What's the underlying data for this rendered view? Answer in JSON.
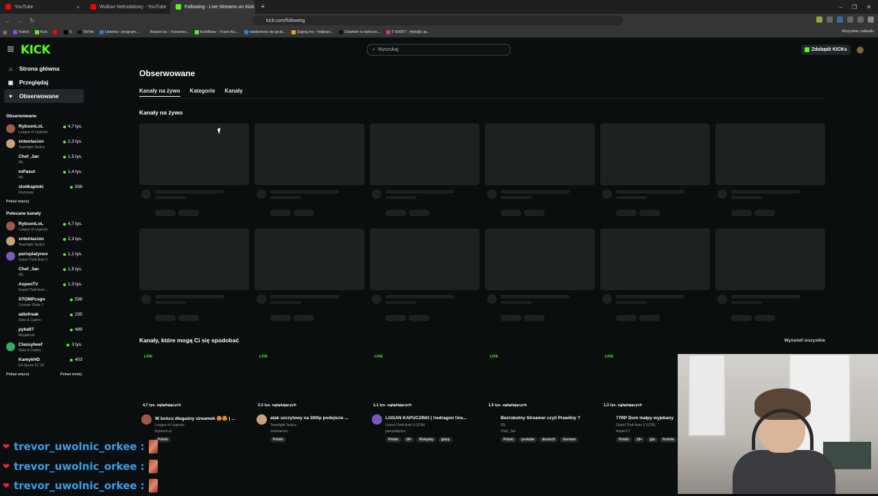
{
  "browser": {
    "tabs": [
      {
        "title": "YouTube",
        "color": "#ff0000",
        "active": false
      },
      {
        "title": "Wulkan Netrodalowy - YouTube",
        "color": "#ff0000",
        "active": false
      },
      {
        "title": "Following - Live Streams on Kick",
        "color": "#53fc18",
        "active": true
      }
    ],
    "url": "kick.com/following",
    "bookmarks": [
      {
        "label": "Twitch",
        "color": "#9146ff"
      },
      {
        "label": "Kick",
        "color": "#53fc18"
      },
      {
        "label": "",
        "color": "#ff0000"
      },
      {
        "label": "X",
        "color": "#000000"
      },
      {
        "label": "TikTok",
        "color": "#111111"
      },
      {
        "label": "Usterka - program...",
        "color": "#2d7dd2"
      },
      {
        "label": "Raszei.eu - Transmis...",
        "color": "#333333"
      },
      {
        "label": "KickBans - Track Kic...",
        "color": "#53fc18"
      },
      {
        "label": "wiadomosc do grub...",
        "color": "#2d7dd2"
      },
      {
        "label": "Zagraj.my - Najleps...",
        "color": "#f0a030"
      },
      {
        "label": "Charkter w twórczo...",
        "color": "#111111"
      },
      {
        "label": "T-SHIRT - #jeb@c ja...",
        "color": "#c83c8a"
      }
    ],
    "bookmarks_right": "Wszystkie zakładki"
  },
  "kick": {
    "logo": "KICK",
    "search_placeholder": "Wyszukaj",
    "kicks_button": "Zdobądź KICKs",
    "nav": [
      {
        "label": "Strona główna",
        "icon": "home-icon",
        "glyph": "⌂",
        "active": false
      },
      {
        "label": "Przeglądaj",
        "icon": "browse-icon",
        "glyph": "▣",
        "active": false
      },
      {
        "label": "Obserwowane",
        "icon": "heart-icon",
        "glyph": "♥",
        "active": true
      }
    ],
    "followed_title": "Obserwowane",
    "followed": [
      {
        "name": "RybsonLoL",
        "category": "League of Legends",
        "viewers": "4,7 tys.",
        "color": "#a0584a"
      },
      {
        "name": "xntentacion",
        "category": "Teamfight Tactics",
        "viewers": "2,3 tys.",
        "color": "#c9a27a"
      },
      {
        "name": "Chef_Jan",
        "category": "IRL",
        "viewers": "1,5 tys.",
        "color": "#0b0e0f"
      },
      {
        "name": "toPasut",
        "category": "IRL",
        "viewers": "1,4 tys.",
        "color": "#0b0e0f"
      },
      {
        "name": "slodkapinki",
        "category": "Rozmowy",
        "viewers": "936",
        "color": "#0b0e0f"
      }
    ],
    "show_more": "Pokaż więcej",
    "recommended_title": "Polecane kanały",
    "recommended": [
      {
        "name": "RybsonLoL",
        "category": "League of Legends",
        "viewers": "4,7 tys.",
        "color": "#a0584a"
      },
      {
        "name": "xntentacion",
        "category": "Teamfight Tactics",
        "viewers": "2,3 tys.",
        "color": "#c9a27a"
      },
      {
        "name": "parisplatynov",
        "category": "Grand Theft Auto V",
        "viewers": "1,1 tys.",
        "color": "#7a5ab8"
      },
      {
        "name": "Chef_Jan",
        "category": "IRL",
        "viewers": "1,5 tys.",
        "color": "#0b0e0f"
      },
      {
        "name": "AspenTV",
        "category": "Grand Theft Auto ...",
        "viewers": "1,3 tys.",
        "color": "#0b0e0f"
      },
      {
        "name": "STOMPcsgo",
        "category": "Counter-Strike 2",
        "viewers": "538",
        "color": "#0b0e0f"
      },
      {
        "name": "adiofreak",
        "category": "Slots & Casino",
        "viewers": "235",
        "color": "#0b0e0f"
      },
      {
        "name": "pyka97",
        "category": "Megabonk",
        "viewers": "489",
        "color": "#0b0e0f"
      },
      {
        "name": "Classybeef",
        "category": "Slots & Casino",
        "viewers": "3 tys.",
        "color": "#3aa860"
      },
      {
        "name": "KamykHD",
        "category": "EA Sports FC 26",
        "viewers": "403",
        "color": "#0b0e0f"
      }
    ],
    "show_more2": "Pokaż więcej",
    "show_less": "Pokaż mniej"
  },
  "main": {
    "title": "Obserwowane",
    "tabs": [
      "Kanały na żywo",
      "Kategorie",
      "Kanały"
    ],
    "live_title": "Kanały na żywo",
    "rec_title": "Kanały, które mogą Ci się spodobać",
    "see_all": "Wyświetl wszystkie",
    "cards": [
      {
        "live": "LIVE",
        "viewers": "4,7 tys. oglądających",
        "title": "W końcu długaśny streamek 😍😍 | ...",
        "category": "League of Legends",
        "channel": "RybsonLoL",
        "tags": [
          "Polski"
        ],
        "avatar": "#a0584a"
      },
      {
        "live": "LIVE",
        "viewers": "2,3 tys. oglądających",
        "title": "atak szczytowy na 300lp podejście ...",
        "category": "Teamfight Tactics",
        "channel": "xntentacion",
        "tags": [
          "Polski"
        ],
        "avatar": "#c9a27a"
      },
      {
        "live": "LIVE",
        "viewers": "1,1 tys. oglądających",
        "title": "LOGAN KAPUCZINO | !redragon !ins...",
        "category": "Grand Theft Auto V (GTA)",
        "channel": "parisplatynov",
        "tags": [
          "Polski",
          "18+",
          "Roleplay",
          "gtarp"
        ],
        "avatar": "#7a5ab8"
      },
      {
        "live": "LIVE",
        "viewers": "1,5 tys. oglądających",
        "title": "Bezrobotny Streamer czyli Prawilny ?",
        "category": "IRL",
        "channel": "Chef_Jan",
        "tags": [
          "Polski",
          "youtube",
          "deutsch",
          "German"
        ],
        "avatar": "#0b0e0f"
      },
      {
        "live": "LIVE",
        "viewers": "1,3 tys. oglądających",
        "title": "77RP Dom małpy wyjebany",
        "category": "Grand Theft Auto V (GTA)",
        "channel": "AspenTV",
        "tags": [
          "Polski",
          "18+",
          "gta",
          "fortnite"
        ],
        "avatar": "#0b0e0f"
      }
    ]
  },
  "chat": [
    {
      "user": "trevor_uwolnic_orkee",
      "sep": ":"
    },
    {
      "user": "trevor_uwolnic_orkee",
      "sep": ":"
    },
    {
      "user": "trevor_uwolnic_orkee",
      "sep": ":"
    }
  ]
}
